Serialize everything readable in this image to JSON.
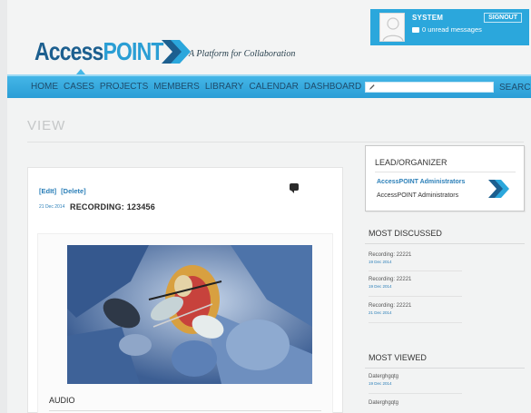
{
  "header": {
    "logo_main": "Access",
    "logo_accent": "POINT",
    "tagline": "A Platform for Collaboration",
    "user_name": "SYSTEM",
    "unread_messages": "0 unread messages",
    "signout_label": "SIGNOUT"
  },
  "nav": {
    "items": [
      "HOME",
      "CASES",
      "PROJECTS",
      "MEMBERS",
      "LIBRARY",
      "CALENDAR",
      "DASHBOARD"
    ],
    "search_placeholder": "",
    "search_label": "SEARCH"
  },
  "page": {
    "title": "VIEW"
  },
  "card": {
    "edit_label": "[EdIt]",
    "delete_label": "[Delete]",
    "date": "21 Dec 2014",
    "title": "RECORDING: 123456",
    "audio_label": "AUDIO"
  },
  "lead": {
    "title": "LEAD/ORGANIZER",
    "name": "AccessPOINT Administrators",
    "subtitle": "AccessPOINT Administrators"
  },
  "most_discussed": {
    "title": "MOST DISCUSSED",
    "items": [
      {
        "title": "Recording: 22221",
        "date": "19 Dec 2014"
      },
      {
        "title": "Recording: 22221",
        "date": "19 Dec 2014"
      },
      {
        "title": "Recording: 22221",
        "date": "21 Dec 2014"
      }
    ]
  },
  "most_viewed": {
    "title": "MOST VIEWED",
    "items": [
      {
        "title": "Daterghgqtg",
        "date": "19 Dec 2014"
      },
      {
        "title": "Daterghgqtg",
        "date": ""
      }
    ]
  },
  "colors": {
    "brand_blue": "#2ba7dc",
    "brand_dark": "#1c5f8f",
    "link_blue": "#2b7fb8"
  }
}
